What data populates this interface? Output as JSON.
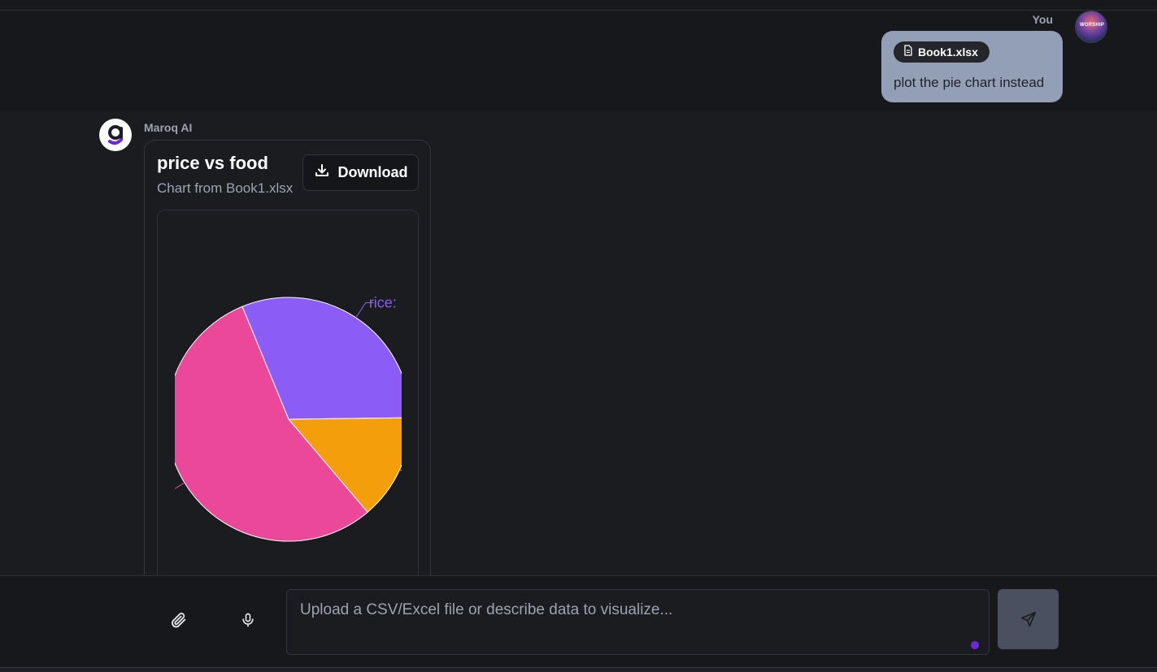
{
  "user_message": {
    "author": "You",
    "attachment": "Book1.xlsx",
    "text": "plot the pie chart instead"
  },
  "ai_message": {
    "author": "Maroq AI",
    "chart_title": "price vs food",
    "chart_subtitle": "Chart from Book1.xlsx",
    "download_label": "Download"
  },
  "composer": {
    "placeholder": "Upload a CSV/Excel file or describe data to visualize..."
  },
  "colors": {
    "rice": "#8b5cf6",
    "orange_slice": "#f59e0b",
    "pink_slice": "#ec4899",
    "background": "#1b1c20",
    "user_bubble": "#939fb5"
  },
  "chart_data": {
    "type": "pie",
    "title": "price vs food",
    "subtitle": "Chart from Book1.xlsx",
    "slices": [
      {
        "label": "rice:",
        "value": 31,
        "color": "#8b5cf6"
      },
      {
        "label": "",
        "value": 14,
        "color": "#f59e0b"
      },
      {
        "label": "",
        "value": 55,
        "color": "#ec4899"
      }
    ]
  }
}
